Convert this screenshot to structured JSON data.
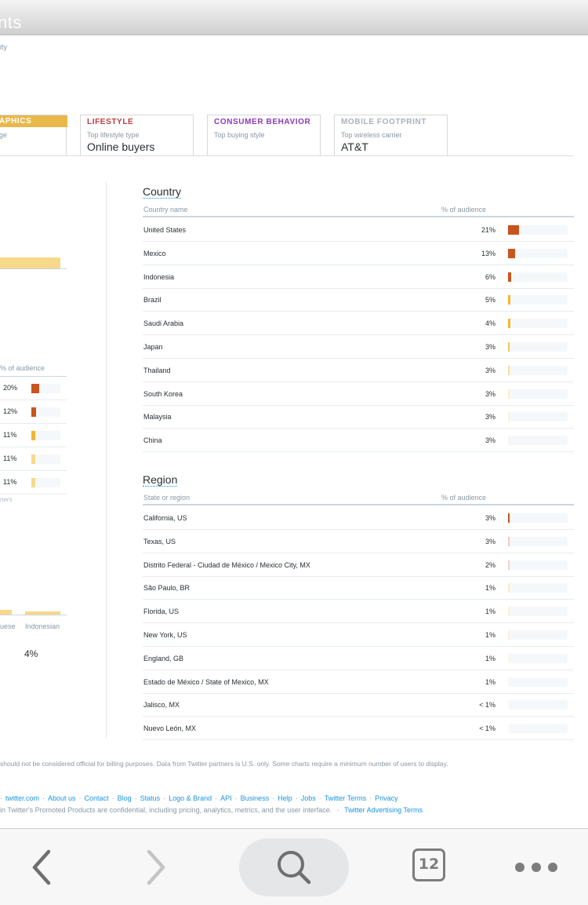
{
  "header": {
    "title_fragment": "nts",
    "subtitle_fragment": "ity"
  },
  "tabs": [
    {
      "caption": "APHICS",
      "sub": "ge",
      "value": ""
    },
    {
      "caption": "LIFESTYLE",
      "sub": "Top lifestyle type",
      "value": "Online buyers"
    },
    {
      "caption": "CONSUMER BEHAVIOR",
      "sub": "Top buying style",
      "value": ""
    },
    {
      "caption": "MOBILE FOOTPRINT",
      "sub": "Top wireless carrier",
      "value": "AT&T"
    }
  ],
  "left_panel": {
    "column_header": "% of audience",
    "rows": [
      {
        "pct": "20%",
        "share": 20,
        "color": "#c8541e"
      },
      {
        "pct": "12%",
        "share": 12,
        "color": "#c8541e"
      },
      {
        "pct": "11%",
        "share": 11,
        "color": "#f3b731"
      },
      {
        "pct": "11%",
        "share": 11,
        "color": "#f6d98a"
      },
      {
        "pct": "11%",
        "share": 11,
        "color": "#f6d98a"
      }
    ],
    "footnote_fragment": "ners",
    "bar_labels": [
      "uese",
      "Indonesian"
    ],
    "big_value": "4%"
  },
  "country": {
    "title": "Country",
    "col_name": "Country name",
    "col_pct": "% of audience",
    "rows": [
      {
        "name": "United States",
        "pct": "21%",
        "share": 21,
        "color": "#c8541e"
      },
      {
        "name": "Mexico",
        "pct": "13%",
        "share": 13,
        "color": "#c8541e"
      },
      {
        "name": "Indonesia",
        "pct": "6%",
        "share": 6,
        "color": "#c8541e"
      },
      {
        "name": "Brazil",
        "pct": "5%",
        "share": 5,
        "color": "#f3b731"
      },
      {
        "name": "Saudi Arabia",
        "pct": "4%",
        "share": 4,
        "color": "#f3b731"
      },
      {
        "name": "Japan",
        "pct": "3%",
        "share": 3,
        "color": "#f3c85a"
      },
      {
        "name": "Thailand",
        "pct": "3%",
        "share": 3,
        "color": "#f8dea0"
      },
      {
        "name": "South Korea",
        "pct": "3%",
        "share": 3,
        "color": "#faebc5"
      },
      {
        "name": "Malaysia",
        "pct": "3%",
        "share": 3,
        "color": "#fbf1dc"
      },
      {
        "name": "China",
        "pct": "3%",
        "share": 3,
        "color": "#fcf5e8"
      }
    ]
  },
  "region": {
    "title": "Region",
    "col_name": "State or region",
    "col_pct": "% of audience",
    "rows": [
      {
        "name": "California, US",
        "pct": "3%",
        "share": 3,
        "color": "#c8541e"
      },
      {
        "name": "Texas, US",
        "pct": "3%",
        "share": 3,
        "color": "#f2c9c3"
      },
      {
        "name": "Distrito Federal - Ciudad de México / Mexico City, MX",
        "pct": "2%",
        "share": 2,
        "color": "#f0d2cf"
      },
      {
        "name": "São Paulo, BR",
        "pct": "1%",
        "share": 1,
        "color": "#fbebc4"
      },
      {
        "name": "Florida, US",
        "pct": "1%",
        "share": 1,
        "color": "#fbf0d5"
      },
      {
        "name": "New York, US",
        "pct": "1%",
        "share": 1,
        "color": "#fbf2dd"
      },
      {
        "name": "England, GB",
        "pct": "1%",
        "share": 1,
        "color": "#fdf7ea"
      },
      {
        "name": "Estado de México / State of Mexico, MX",
        "pct": "1%",
        "share": 1,
        "color": "#fdf8ee"
      },
      {
        "name": "Jalisco, MX",
        "pct": "< 1%",
        "share": 0.5,
        "color": "#fdf9f2"
      },
      {
        "name": "Nuevo León, MX",
        "pct": "< 1%",
        "share": 0.5,
        "color": "#fdfaf4"
      }
    ]
  },
  "footer": {
    "disclaimer": "should not be considered official for billing purposes. Data from Twitter partners is U.S. only. Some charts require a minimum number of users to display.",
    "links": [
      "twitter.com",
      "About us",
      "Contact",
      "Blog",
      "Status",
      "Logo & Brand",
      "API",
      "Business",
      "Help",
      "Jobs",
      "Twitter Terms",
      "Privacy"
    ],
    "legal_text": "in Twitter's Promoted Products are confidential, including pricing, analytics, metrics, and the user interface.",
    "legal_link": "Twitter Advertising Terms"
  },
  "browser": {
    "tab_count": "12"
  },
  "icons": [
    "back-icon",
    "forward-icon",
    "search-icon",
    "tabs-icon",
    "more-icon"
  ]
}
